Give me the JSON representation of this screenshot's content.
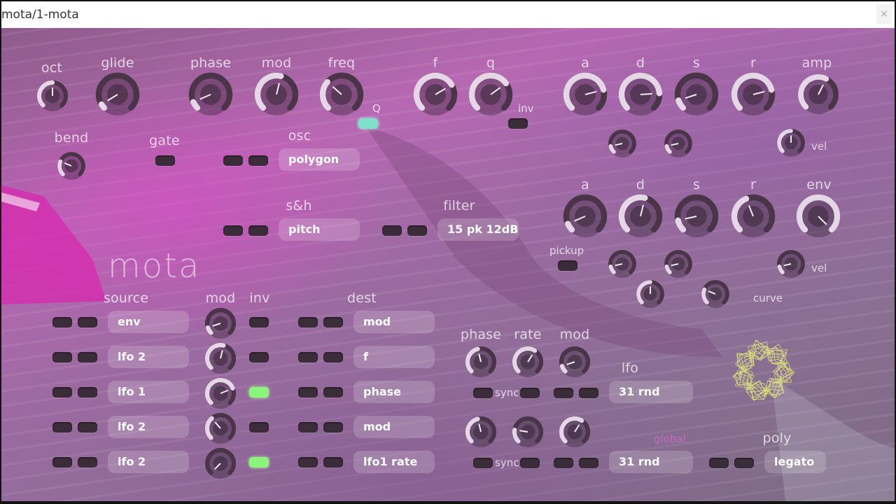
{
  "window": {
    "title": "mota/1-mota",
    "close_label": "×"
  },
  "logo": "mota",
  "labels": {
    "oct": "oct",
    "glide": "glide",
    "phase": "phase",
    "mod": "mod",
    "freq": "freq",
    "f": "f",
    "q": "q",
    "a": "a",
    "d": "d",
    "s": "s",
    "r": "r",
    "amp": "amp",
    "env": "env",
    "Q": "Q",
    "inv": "inv",
    "vel": "vel",
    "bend": "bend",
    "gate": "gate",
    "osc": "osc",
    "sh": "s&h",
    "filter": "filter",
    "pickup": "pickup",
    "curve": "curve",
    "source": "source",
    "dest": "dest",
    "rate": "rate",
    "lfo": "lfo",
    "sync": "sync",
    "global": "global",
    "poly": "poly"
  },
  "selectors": {
    "osc": "polygon",
    "sh": "pitch",
    "filter": "15 pk 12dB",
    "lfo1": "31 rnd",
    "lfo2": "31 rnd",
    "poly": "legato"
  },
  "mod_matrix": [
    {
      "source": "env",
      "dest": "mod",
      "inv": false
    },
    {
      "source": "lfo 2",
      "dest": "f",
      "inv": false
    },
    {
      "source": "lfo 1",
      "dest": "phase",
      "inv": true
    },
    {
      "source": "lfo 2",
      "dest": "mod",
      "inv": false
    },
    {
      "source": "lfo 2",
      "dest": "lfo1 rate",
      "inv": true
    }
  ],
  "colors": {
    "accent": "#e6d7e6",
    "toggle_on": "#8af57a",
    "q_toggle": "#7ee0c8",
    "global_label": "#c36bc3",
    "knob_track": "#4a3548"
  }
}
